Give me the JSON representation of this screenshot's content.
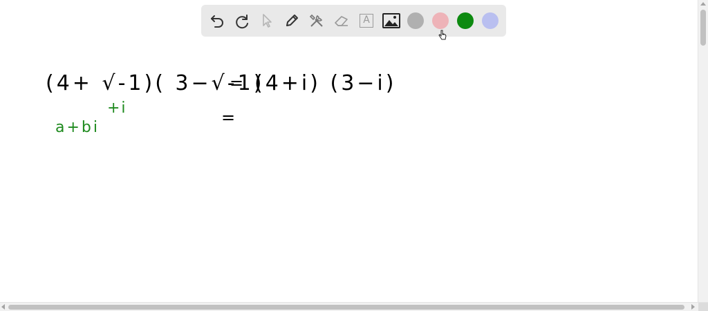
{
  "toolbar": {
    "tools": [
      {
        "name": "undo",
        "icon": "undo-icon"
      },
      {
        "name": "redo",
        "icon": "redo-icon"
      },
      {
        "name": "select",
        "icon": "pointer-icon"
      },
      {
        "name": "pen",
        "icon": "pen-icon"
      },
      {
        "name": "tools",
        "icon": "tools-icon"
      },
      {
        "name": "eraser",
        "icon": "eraser-icon"
      },
      {
        "name": "text",
        "icon": "text-icon"
      },
      {
        "name": "image",
        "icon": "image-icon"
      }
    ],
    "text_tool_glyph": "A",
    "colors": [
      "#b0b0b0",
      "#eeb3b8",
      "#0d8a10",
      "#b9bff0"
    ]
  },
  "canvas": {
    "ink_color": "#000000",
    "note_color": "#1e8a1e",
    "line1": {
      "lhs": "(4+ √-1)( 3−√-1)",
      "eq": "=",
      "rhs": "(4+i) (3−i)"
    },
    "line2": {
      "eq": "="
    },
    "notes": {
      "abi": "a+bi",
      "ti": "+i"
    }
  }
}
